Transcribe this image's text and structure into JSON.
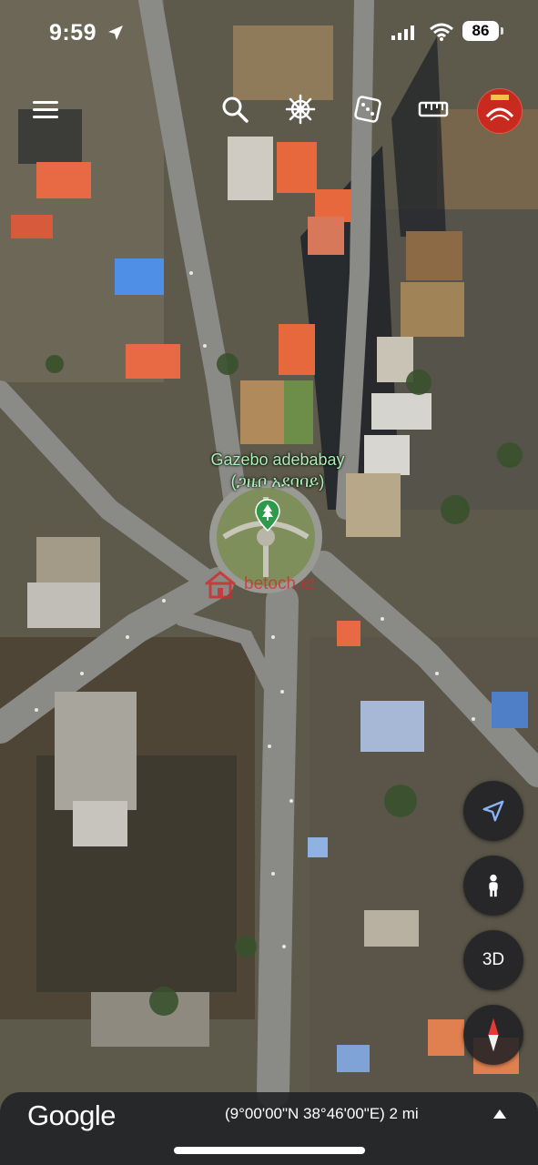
{
  "status_bar": {
    "time": "9:59",
    "battery": "86"
  },
  "toolbar": {
    "icons": [
      "menu-icon",
      "search-icon",
      "voyager-icon",
      "dice-icon",
      "ruler-icon",
      "avatar"
    ]
  },
  "map": {
    "type": "satellite",
    "place_label": {
      "name_en": "Gazebo adebabay",
      "name_am": "(ጋዜቦ አደባባይ)",
      "color": "#a8f0b4"
    },
    "watermark": "betoch.et"
  },
  "controls": {
    "three_d_label": "3D"
  },
  "bottom_bar": {
    "logo": "Google",
    "coordinates": "(9°00'00\"N 38°46'00\"E) 2 mi"
  }
}
